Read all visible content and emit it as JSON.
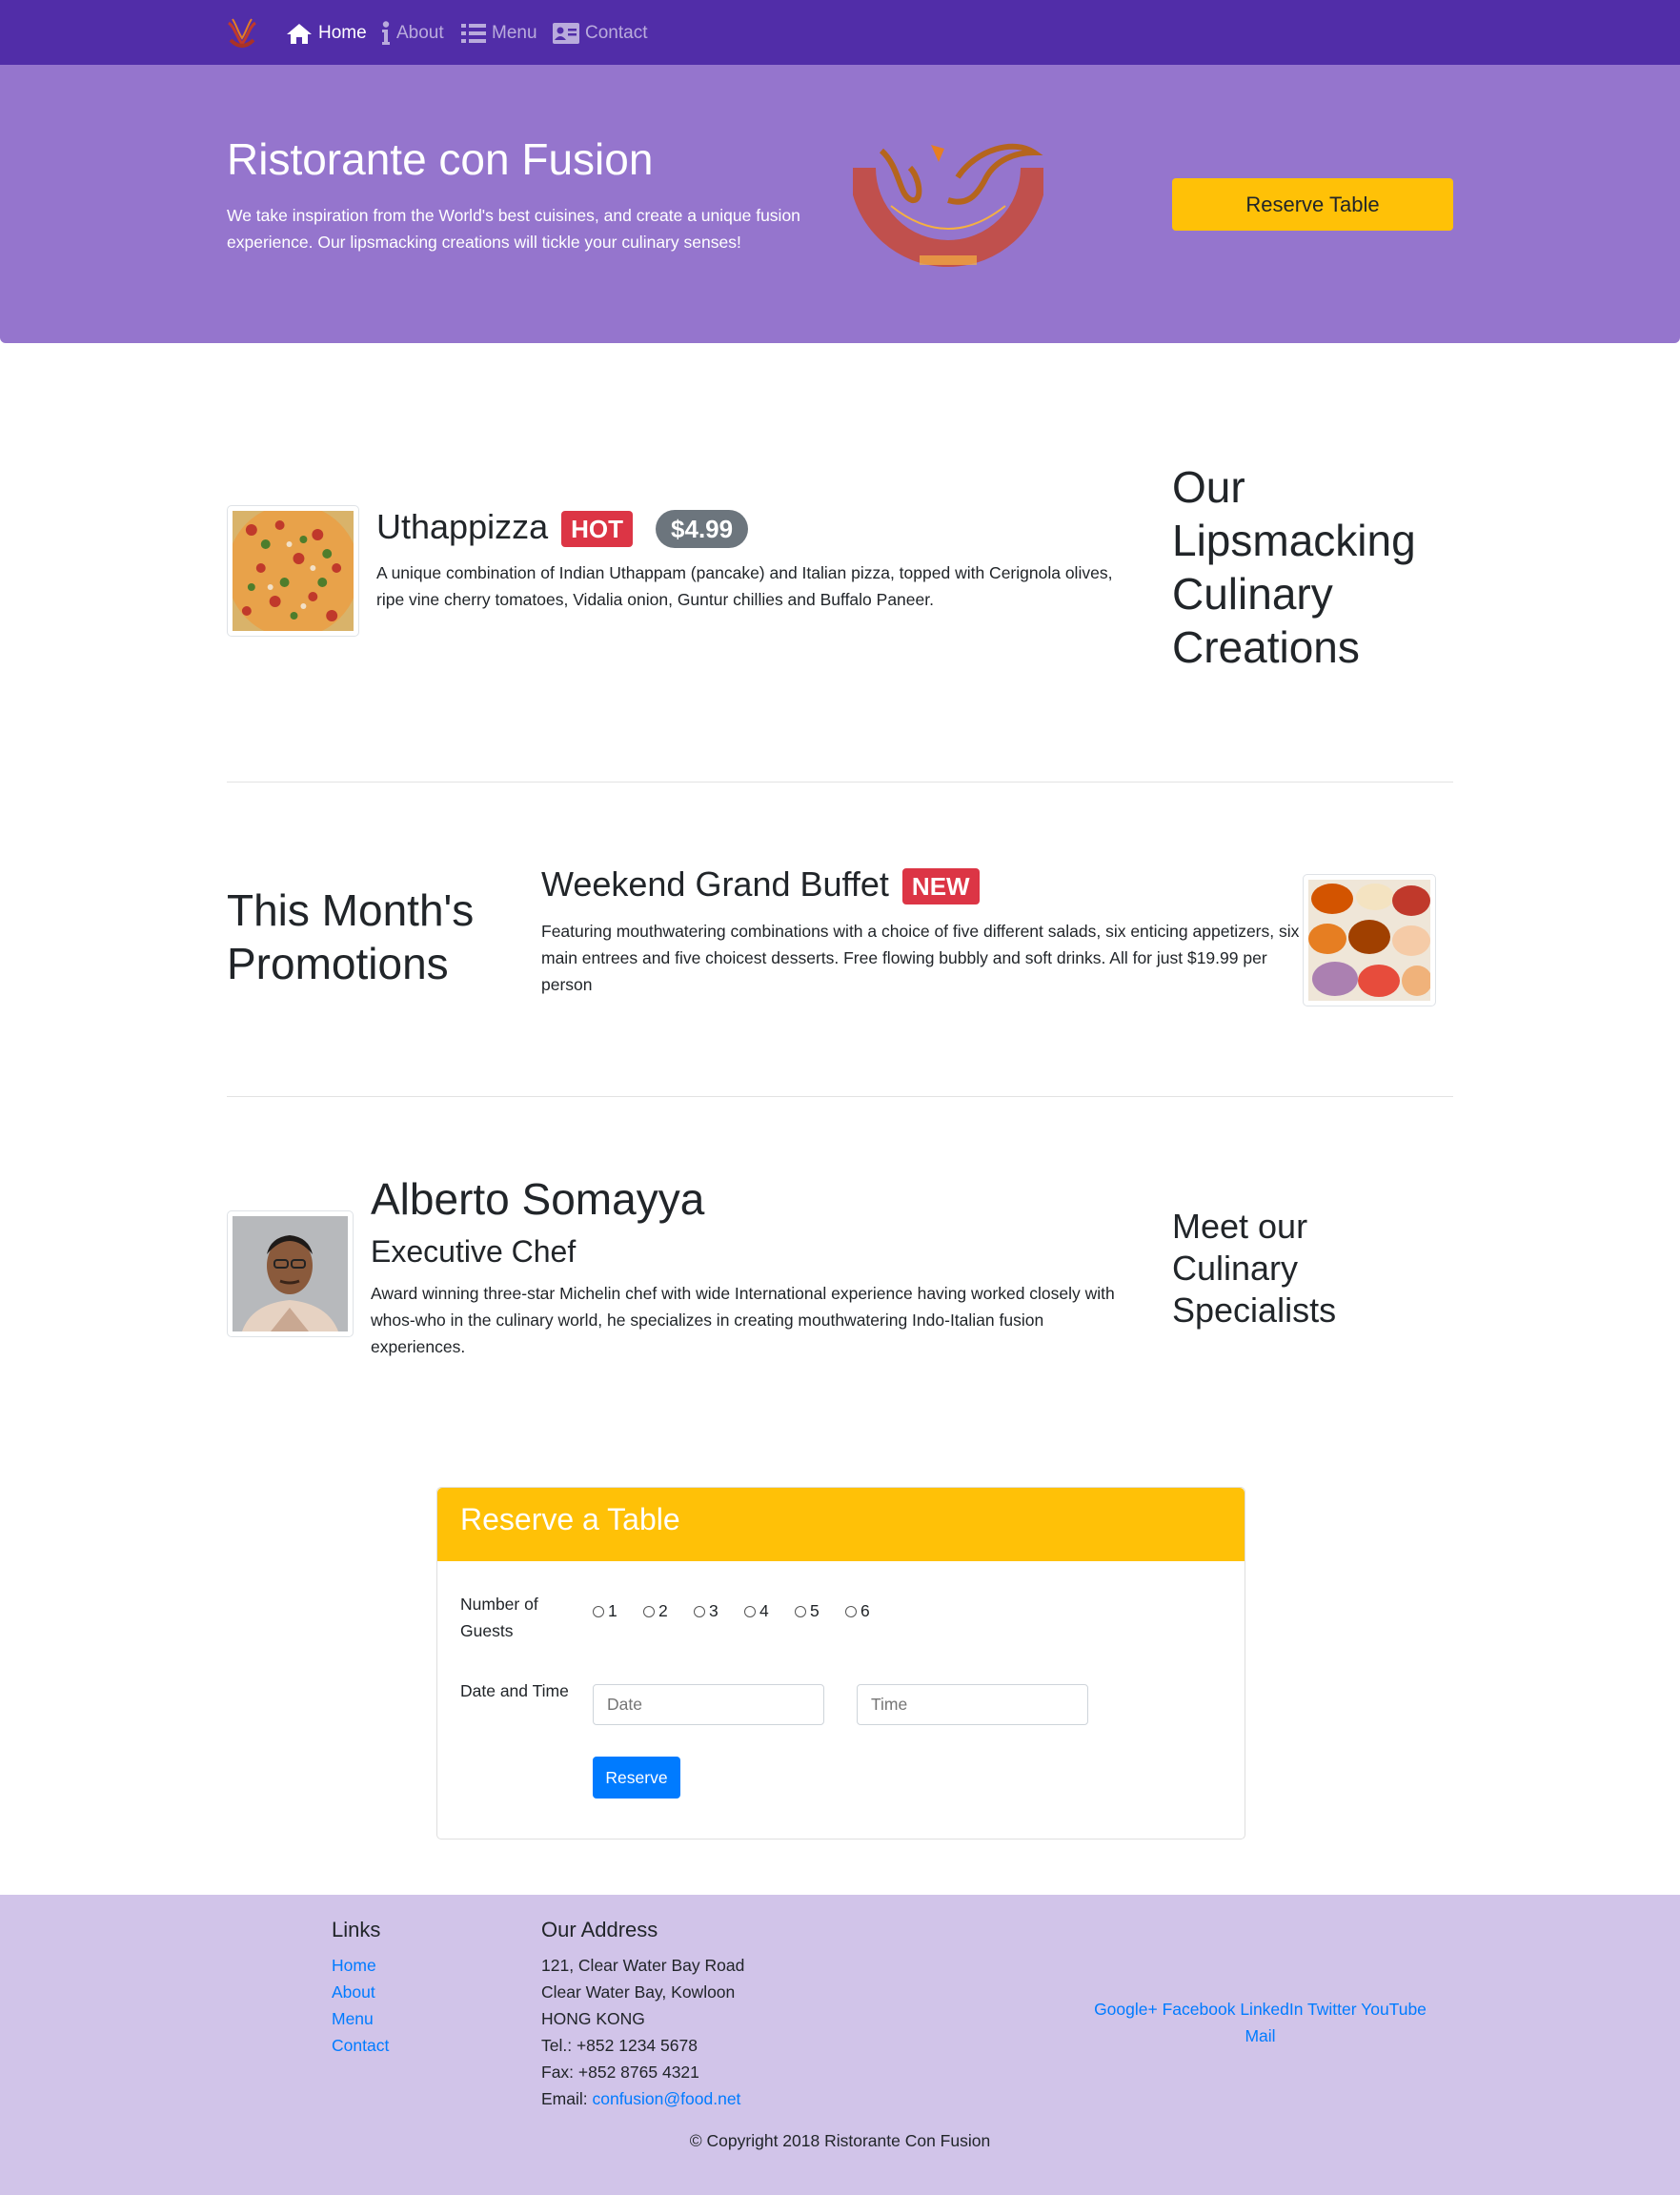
{
  "nav": {
    "items": [
      {
        "label": "Home",
        "icon": "home-icon",
        "active": true
      },
      {
        "label": "About",
        "icon": "info-icon",
        "active": false
      },
      {
        "label": "Menu",
        "icon": "list-icon",
        "active": false
      },
      {
        "label": "Contact",
        "icon": "address-card-icon",
        "active": false
      }
    ]
  },
  "jumbotron": {
    "title": "Ristorante con Fusion",
    "text": "We take inspiration from the World's best cuisines, and create a unique fusion experience. Our lipsmacking creations will tickle your culinary senses!",
    "button_label": "Reserve Table"
  },
  "dish": {
    "name": "Uthappizza",
    "badge": "HOT",
    "price": "$4.99",
    "description": "A unique combination of Indian Uthappam (pancake) and Italian pizza, topped with Cerignola olives, ripe vine cherry tomatoes, Vidalia onion, Guntur chillies and Buffalo Paneer.",
    "section_heading": "Our Lipsmacking Culinary Creations"
  },
  "promotion": {
    "section_heading": "This Month's Promotions",
    "name": "Weekend Grand Buffet",
    "badge": "NEW",
    "description": "Featuring mouthwatering combinations with a choice of five different salads, six enticing appetizers, six main entrees and five choicest desserts. Free flowing bubbly and soft drinks. All for just $19.99 per person"
  },
  "leader": {
    "name": "Alberto Somayya",
    "designation": "Executive Chef",
    "description": "Award winning three-star Michelin chef with wide International experience having worked closely with whos-who in the culinary world, he specializes in creating mouthwatering Indo-Italian fusion experiences.",
    "section_heading": "Meet our Culinary Specialists"
  },
  "reservation": {
    "title": "Reserve a Table",
    "guests_label": "Number of Guests",
    "guest_options": [
      "1",
      "2",
      "3",
      "4",
      "5",
      "6"
    ],
    "datetime_label": "Date and Time",
    "date_placeholder": "Date",
    "time_placeholder": "Time",
    "submit_label": "Reserve"
  },
  "footer": {
    "links_heading": "Links",
    "links": [
      "Home",
      "About",
      "Menu",
      "Contact"
    ],
    "address_heading": "Our Address",
    "address_lines": [
      "121, Clear Water Bay Road",
      "Clear Water Bay, Kowloon",
      "HONG KONG",
      "Tel.: +852 1234 5678",
      "Fax: +852 8765 4321"
    ],
    "email_label": "Email: ",
    "email": "confusion@food.net",
    "social": [
      "Google+",
      "Facebook",
      "LinkedIn",
      "Twitter",
      "YouTube",
      "Mail"
    ],
    "copyright": "© Copyright 2018 Ristorante Con Fusion"
  },
  "colors": {
    "navbar": "#512DA8",
    "jumbotron": "#9575CD",
    "footer": "#D1C4E9",
    "warning": "#FFC107",
    "danger": "#dc3545",
    "secondary": "#6c757d",
    "primary": "#007bff"
  }
}
